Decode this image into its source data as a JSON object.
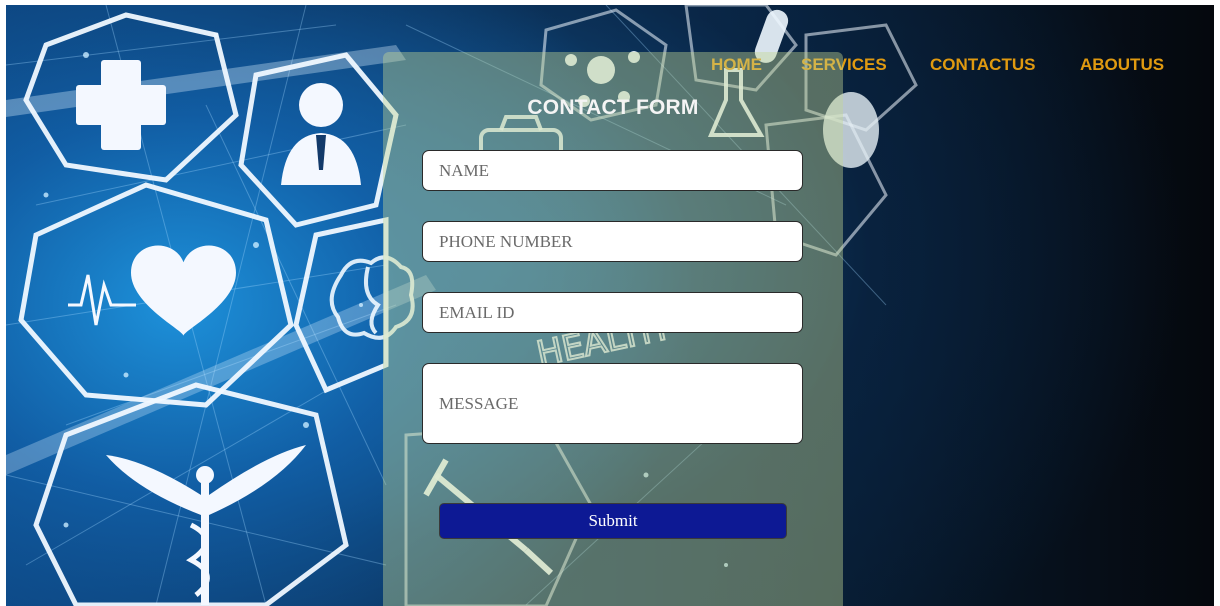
{
  "nav": {
    "items": [
      {
        "id": "home",
        "label": "HOME"
      },
      {
        "id": "services",
        "label": "SERVICES"
      },
      {
        "id": "contactus",
        "label": "CONTACTUS"
      },
      {
        "id": "aboutus",
        "label": "ABOUTUS"
      }
    ]
  },
  "form": {
    "title": "CONTACT FORM",
    "name_placeholder": "NAME",
    "phone_placeholder": "PHONE NUMBER",
    "email_placeholder": "EMAIL ID",
    "message_placeholder": "MESSAGE",
    "submit_label": "Submit"
  },
  "colors": {
    "nav_text": "#e09a10",
    "panel_tint": "#c4d694",
    "submit_bg": "#0d1994",
    "background_blue": "#1e96e1",
    "background_dark": "#05080d"
  },
  "icons": [
    "medical-cross-icon",
    "doctor-icon",
    "heart-pulse-icon",
    "caduceus-icon",
    "brain-icon",
    "syringe-icon",
    "molecule-icon",
    "flask-icon",
    "pill-icon",
    "medical-bag-icon"
  ]
}
